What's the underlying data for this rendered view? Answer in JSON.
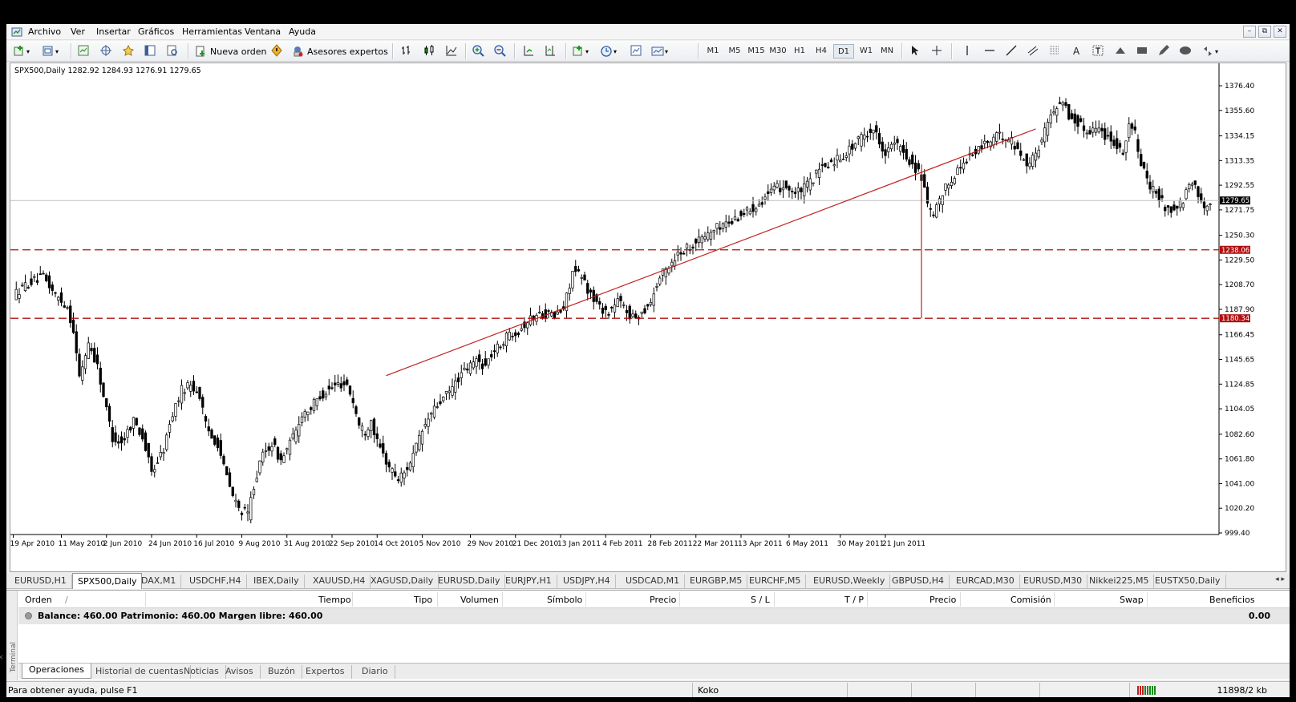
{
  "menu": [
    "Archivo",
    "Ver",
    "Insertar",
    "Gráficos",
    "Herramientas",
    "Ventana",
    "Ayuda"
  ],
  "window_buttons": [
    "–",
    "⧉",
    "✕"
  ],
  "toolbar": {
    "new_order": "Nueva orden",
    "experts": "Asesores expertos",
    "timeframes": [
      "M1",
      "M5",
      "M15",
      "M30",
      "H1",
      "H4",
      "D1",
      "W1",
      "MN"
    ],
    "active_timeframe": "D1",
    "text_tool": "A"
  },
  "chart": {
    "header": "SPX500,Daily  1282.92 1284.93 1276.91 1279.65",
    "bid": 1279.65,
    "bid_label": "1279.65",
    "target_levels": [
      {
        "value": 1238.06,
        "label": "1238.06"
      },
      {
        "value": 1180.34,
        "label": "1180.34"
      }
    ],
    "colors": {
      "level": "#b01010",
      "trend": "#c02020",
      "candle_up": "#ffffff",
      "candle_down": "#000000"
    }
  },
  "chart_data": {
    "type": "candlestick",
    "ylim": [
      999.4,
      1376.4
    ],
    "y_ticks": [
      "1376.40",
      "1355.60",
      "1334.15",
      "1313.35",
      "1292.55",
      "1271.75",
      "1250.30",
      "1229.50",
      "1208.70",
      "1187.90",
      "1166.45",
      "1145.65",
      "1124.85",
      "1104.05",
      "1082.60",
      "1061.80",
      "1041.00",
      "1020.20",
      "999.40"
    ],
    "x_labels": [
      "19 Apr 2010",
      "11 May 2010",
      "2 Jun 2010",
      "24 Jun 2010",
      "16 Jul 2010",
      "9 Aug 2010",
      "31 Aug 2010",
      "22 Sep 2010",
      "14 Oct 2010",
      "5 Nov 2010",
      "29 Nov 2010",
      "21 Dec 2010",
      "13 Jan 2011",
      "4 Feb 2011",
      "28 Feb 2011",
      "22 Mar 2011",
      "13 Apr 2011",
      "6 May 2011",
      "30 May 2011",
      "21 Jun 2011"
    ],
    "close_path": [
      [
        0,
        1200
      ],
      [
        5,
        1210
      ],
      [
        10,
        1215
      ],
      [
        14,
        1200
      ],
      [
        18,
        1190
      ],
      [
        20,
        1170
      ],
      [
        22,
        1130
      ],
      [
        25,
        1160
      ],
      [
        28,
        1140
      ],
      [
        30,
        1115
      ],
      [
        33,
        1080
      ],
      [
        36,
        1075
      ],
      [
        40,
        1095
      ],
      [
        43,
        1080
      ],
      [
        46,
        1050
      ],
      [
        50,
        1070
      ],
      [
        53,
        1100
      ],
      [
        56,
        1120
      ],
      [
        59,
        1125
      ],
      [
        62,
        1115
      ],
      [
        64,
        1090
      ],
      [
        66,
        1080
      ],
      [
        68,
        1075
      ],
      [
        70,
        1055
      ],
      [
        73,
        1030
      ],
      [
        75,
        1020
      ],
      [
        78,
        1015
      ],
      [
        80,
        1040
      ],
      [
        83,
        1065
      ],
      [
        86,
        1075
      ],
      [
        89,
        1060
      ],
      [
        91,
        1070
      ],
      [
        94,
        1085
      ],
      [
        96,
        1100
      ],
      [
        99,
        1105
      ],
      [
        102,
        1115
      ],
      [
        105,
        1120
      ],
      [
        108,
        1125
      ],
      [
        111,
        1125
      ],
      [
        113,
        1110
      ],
      [
        115,
        1090
      ],
      [
        117,
        1085
      ],
      [
        119,
        1095
      ],
      [
        121,
        1075
      ],
      [
        123,
        1065
      ],
      [
        125,
        1055
      ],
      [
        128,
        1045
      ],
      [
        130,
        1050
      ],
      [
        133,
        1065
      ],
      [
        136,
        1085
      ],
      [
        139,
        1100
      ],
      [
        142,
        1110
      ],
      [
        145,
        1118
      ],
      [
        148,
        1130
      ],
      [
        151,
        1138
      ],
      [
        154,
        1145
      ],
      [
        157,
        1140
      ],
      [
        159,
        1150
      ],
      [
        162,
        1158
      ],
      [
        165,
        1168
      ],
      [
        168,
        1170
      ],
      [
        171,
        1178
      ],
      [
        174,
        1183
      ],
      [
        177,
        1185
      ],
      [
        180,
        1182
      ],
      [
        183,
        1188
      ],
      [
        186,
        1220
      ],
      [
        189,
        1215
      ],
      [
        192,
        1200
      ],
      [
        195,
        1190
      ],
      [
        198,
        1185
      ],
      [
        201,
        1195
      ],
      [
        203,
        1190
      ],
      [
        206,
        1180
      ],
      [
        209,
        1185
      ],
      [
        212,
        1195
      ],
      [
        215,
        1215
      ],
      [
        218,
        1225
      ],
      [
        221,
        1235
      ],
      [
        224,
        1240
      ],
      [
        227,
        1245
      ],
      [
        230,
        1250
      ],
      [
        233,
        1255
      ],
      [
        236,
        1260
      ],
      [
        239,
        1262
      ],
      [
        242,
        1268
      ],
      [
        245,
        1272
      ],
      [
        248,
        1278
      ],
      [
        251,
        1285
      ],
      [
        254,
        1290
      ],
      [
        257,
        1292
      ],
      [
        260,
        1285
      ],
      [
        263,
        1290
      ],
      [
        265,
        1295
      ],
      [
        268,
        1305
      ],
      [
        271,
        1310
      ],
      [
        274,
        1315
      ],
      [
        277,
        1320
      ],
      [
        280,
        1328
      ],
      [
        283,
        1335
      ],
      [
        286,
        1340
      ],
      [
        288,
        1330
      ],
      [
        290,
        1320
      ],
      [
        293,
        1328
      ],
      [
        296,
        1320
      ],
      [
        299,
        1310
      ],
      [
        302,
        1300
      ],
      [
        304,
        1275
      ],
      [
        306,
        1265
      ],
      [
        308,
        1280
      ],
      [
        311,
        1295
      ],
      [
        314,
        1305
      ],
      [
        317,
        1315
      ],
      [
        320,
        1320
      ],
      [
        323,
        1328
      ],
      [
        326,
        1332
      ],
      [
        329,
        1335
      ],
      [
        332,
        1330
      ],
      [
        335,
        1318
      ],
      [
        338,
        1310
      ],
      [
        341,
        1325
      ],
      [
        344,
        1345
      ],
      [
        347,
        1360
      ],
      [
        349,
        1365
      ],
      [
        351,
        1350
      ],
      [
        354,
        1345
      ],
      [
        357,
        1338
      ],
      [
        360,
        1342
      ],
      [
        363,
        1335
      ],
      [
        366,
        1330
      ],
      [
        369,
        1320
      ],
      [
        371,
        1345
      ],
      [
        373,
        1335
      ],
      [
        375,
        1312
      ],
      [
        377,
        1295
      ],
      [
        380,
        1285
      ],
      [
        383,
        1275
      ],
      [
        386,
        1270
      ],
      [
        389,
        1280
      ],
      [
        392,
        1295
      ],
      [
        394,
        1285
      ],
      [
        396,
        1275
      ],
      [
        398,
        1280
      ]
    ]
  },
  "symbol_tabs": [
    "EURUSD,H1",
    "SPX500,Daily",
    "DAX,M1",
    "USDCHF,H4",
    "IBEX,Daily",
    "XAUUSD,H4",
    "XAGUSD,Daily",
    "EURUSD,Daily",
    "EURJPY,H1",
    "USDJPY,H4",
    "USDCAD,M1",
    "EURGBP,M5",
    "EURCHF,M5",
    "EURUSD,Weekly",
    "GBPUSD,H4",
    "EURCAD,M30",
    "EURUSD,M30",
    "Nikkei225,M5",
    "EUSTX50,Daily"
  ],
  "active_symbol_tab": "SPX500,Daily",
  "tab_arrows": "◂ ▸",
  "terminal": {
    "side_label": "Terminal",
    "close": "✕",
    "columns": [
      "Orden",
      "/",
      "Tiempo",
      "Tipo",
      "Volumen",
      "Símbolo",
      "Precio",
      "S / L",
      "T / P",
      "Precio",
      "Comisión",
      "Swap",
      "Beneficios"
    ],
    "balance_text": "Balance: 460.00  Patrimonio: 460.00  Margen libre: 460.00",
    "profit": "0.00",
    "tabs": [
      "Operaciones",
      "Historial de cuentas",
      "Noticias",
      "Avisos",
      "Buzón",
      "Expertos",
      "Diario"
    ],
    "active_tab": "Operaciones"
  },
  "status": {
    "help": "Para obtener ayuda, pulse F1",
    "profile": "Koko",
    "traffic": "11898/2 kb"
  }
}
